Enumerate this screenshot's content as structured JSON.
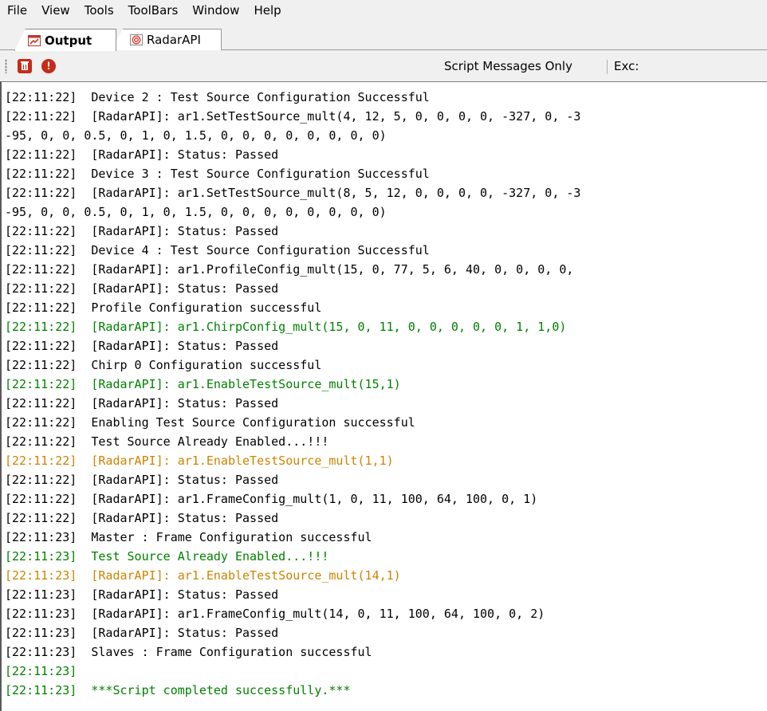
{
  "menu": {
    "items": [
      "File",
      "View",
      "Tools",
      "ToolBars",
      "Window",
      "Help"
    ]
  },
  "tabs": [
    {
      "label": "Output",
      "icon": "output-window-icon",
      "active": true
    },
    {
      "label": "RadarAPI",
      "icon": "radar-icon",
      "active": false
    }
  ],
  "toolbar": {
    "clear_icon": "clear-output-icon",
    "error_icon": "error-icon",
    "script_messages_only": "Script Messages Only",
    "exc_label": "Exc:"
  },
  "colors": {
    "default": "#000000",
    "green": "#008000",
    "orange": "#cc8400"
  },
  "log": [
    {
      "text": "[22:11:22]  Device 2 : Test Source Configuration Successful",
      "color": "black"
    },
    {
      "text": "[22:11:22]  [RadarAPI]: ar1.SetTestSource_mult(4, 12, 5, 0, 0, 0, 0, -327, 0, -3",
      "color": "black"
    },
    {
      "text": "-95, 0, 0, 0.5, 0, 1, 0, 1.5, 0, 0, 0, 0, 0, 0, 0, 0)",
      "color": "black"
    },
    {
      "text": "[22:11:22]  [RadarAPI]: Status: Passed",
      "color": "black"
    },
    {
      "text": "[22:11:22]  Device 3 : Test Source Configuration Successful",
      "color": "black"
    },
    {
      "text": "[22:11:22]  [RadarAPI]: ar1.SetTestSource_mult(8, 5, 12, 0, 0, 0, 0, -327, 0, -3",
      "color": "black"
    },
    {
      "text": "-95, 0, 0, 0.5, 0, 1, 0, 1.5, 0, 0, 0, 0, 0, 0, 0, 0)",
      "color": "black"
    },
    {
      "text": "[22:11:22]  [RadarAPI]: Status: Passed",
      "color": "black"
    },
    {
      "text": "[22:11:22]  Device 4 : Test Source Configuration Successful",
      "color": "black"
    },
    {
      "text": "[22:11:22]  [RadarAPI]: ar1.ProfileConfig_mult(15, 0, 77, 5, 6, 40, 0, 0, 0, 0,",
      "color": "black"
    },
    {
      "text": "[22:11:22]  [RadarAPI]: Status: Passed",
      "color": "black"
    },
    {
      "text": "[22:11:22]  Profile Configuration successful",
      "color": "black"
    },
    {
      "text": "[22:11:22]  [RadarAPI]: ar1.ChirpConfig_mult(15, 0, 11, 0, 0, 0, 0, 0, 1, 1,0)",
      "color": "green"
    },
    {
      "text": "[22:11:22]  [RadarAPI]: Status: Passed",
      "color": "black"
    },
    {
      "text": "[22:11:22]  Chirp 0 Configuration successful",
      "color": "black"
    },
    {
      "text": "[22:11:22]  [RadarAPI]: ar1.EnableTestSource_mult(15,1)",
      "color": "green"
    },
    {
      "text": "[22:11:22]  [RadarAPI]: Status: Passed",
      "color": "black"
    },
    {
      "text": "[22:11:22]  Enabling Test Source Configuration successful",
      "color": "black"
    },
    {
      "text": "[22:11:22]  Test Source Already Enabled...!!!",
      "color": "black"
    },
    {
      "text": "[22:11:22]  [RadarAPI]: ar1.EnableTestSource_mult(1,1)",
      "color": "orange"
    },
    {
      "text": "[22:11:22]  [RadarAPI]: Status: Passed",
      "color": "black"
    },
    {
      "text": "[22:11:22]  [RadarAPI]: ar1.FrameConfig_mult(1, 0, 11, 100, 64, 100, 0, 1)",
      "color": "black"
    },
    {
      "text": "[22:11:22]  [RadarAPI]: Status: Passed",
      "color": "black"
    },
    {
      "text": "[22:11:23]  Master : Frame Configuration successful",
      "color": "black"
    },
    {
      "text": "[22:11:23]  Test Source Already Enabled...!!!",
      "color": "green"
    },
    {
      "text": "[22:11:23]  [RadarAPI]: ar1.EnableTestSource_mult(14,1)",
      "color": "orange"
    },
    {
      "text": "[22:11:23]  [RadarAPI]: Status: Passed",
      "color": "black"
    },
    {
      "text": "[22:11:23]  [RadarAPI]: ar1.FrameConfig_mult(14, 0, 11, 100, 64, 100, 0, 2)",
      "color": "black"
    },
    {
      "text": "[22:11:23]  [RadarAPI]: Status: Passed",
      "color": "black"
    },
    {
      "text": "[22:11:23]  Slaves : Frame Configuration successful",
      "color": "black"
    },
    {
      "text": "[22:11:23]",
      "color": "green"
    },
    {
      "text": "[22:11:23]  ***Script completed successfully.***",
      "color": "green"
    }
  ]
}
